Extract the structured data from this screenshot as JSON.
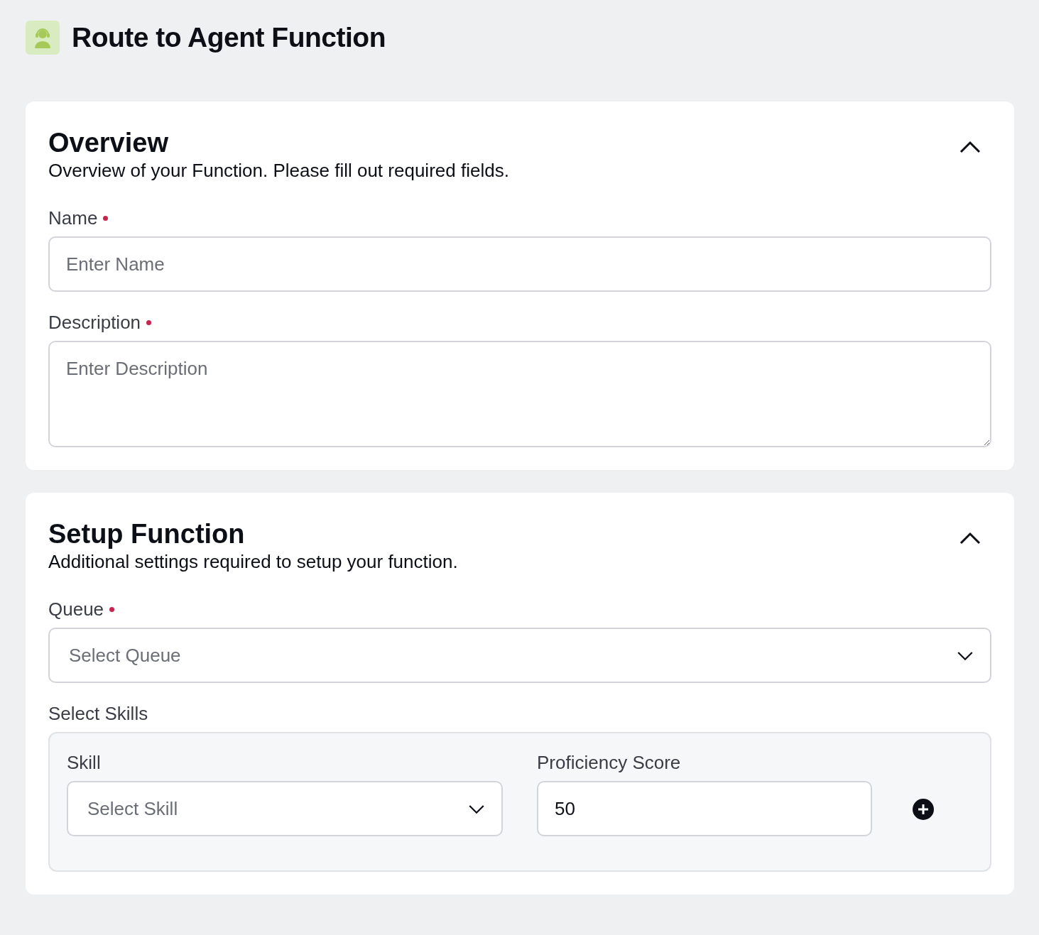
{
  "header": {
    "title": "Route to Agent Function"
  },
  "sections": [
    {
      "title": "Overview",
      "subtitle": "Overview of your Function. Please fill out required fields.",
      "expanded": true,
      "fields": [
        {
          "kind": "text",
          "label": "Name",
          "required": true,
          "placeholder": "Enter Name"
        },
        {
          "kind": "textarea",
          "label": "Description",
          "required": true,
          "placeholder": "Enter Description"
        }
      ]
    },
    {
      "title": "Setup Function",
      "subtitle": "Additional settings required to setup your function.",
      "expanded": true,
      "fields": [
        {
          "kind": "select",
          "label": "Queue",
          "required": true,
          "placeholder": "Select Queue"
        },
        {
          "kind": "skills",
          "label": "Select Skills",
          "required": false,
          "skill": {
            "label": "Skill",
            "placeholder": "Select Skill"
          },
          "score": {
            "label": "Proficiency Score",
            "value": "50"
          }
        }
      ]
    }
  ]
}
